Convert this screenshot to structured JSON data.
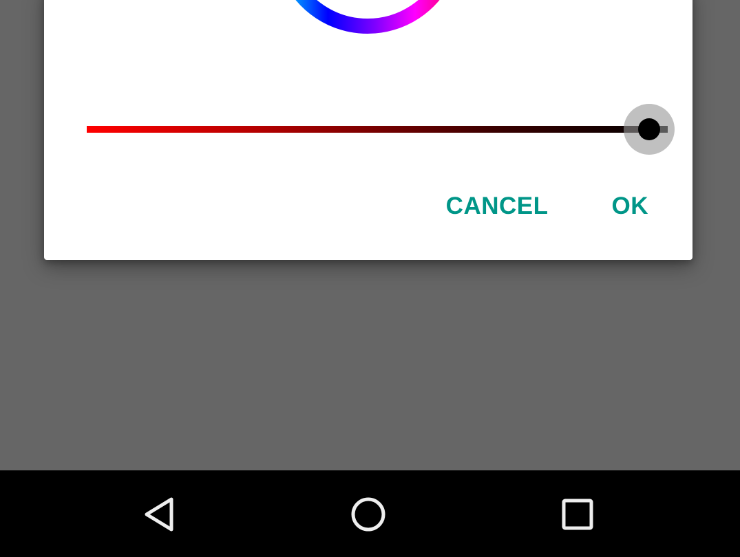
{
  "colors": {
    "scrim": "#666666",
    "dialog_background": "#ffffff",
    "accent": "#009688",
    "slider_start": "#ff0000",
    "slider_end": "#000000",
    "navbar": "#000000",
    "nav_icon": "#eeeeee"
  },
  "dialog": {
    "color_wheel_icon": "color-wheel",
    "value_slider": {
      "value": 1.0,
      "icon": "slider-thumb"
    },
    "cancel_label": "CANCEL",
    "ok_label": "OK"
  },
  "navbar": {
    "back_icon": "back-triangle-icon",
    "home_icon": "home-circle-icon",
    "recents_icon": "recents-square-icon"
  }
}
